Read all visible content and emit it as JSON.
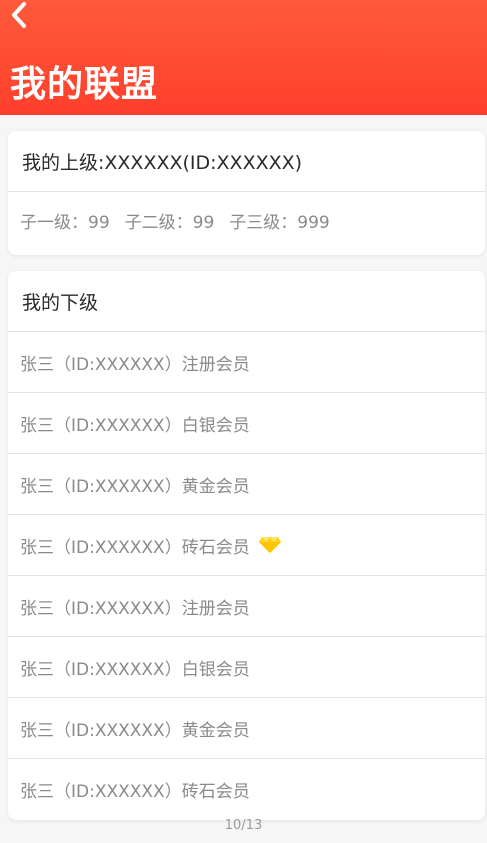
{
  "header": {
    "title": "我的联盟"
  },
  "superior": {
    "heading": "我的上级:XXXXXX(ID:XXXXXX)",
    "counts": [
      {
        "text": "子一级：99"
      },
      {
        "text": "子二级：99"
      },
      {
        "text": "子三级：999"
      }
    ]
  },
  "subordinates": {
    "heading": "我的下级",
    "rows": [
      {
        "text": "张三（ID:XXXXXX）注册会员"
      },
      {
        "text": "张三（ID:XXXXXX）白银会员"
      },
      {
        "text": "张三（ID:XXXXXX）黄金会员"
      },
      {
        "text": "张三（ID:XXXXXX）砖石会员",
        "badge_icon": "diamond-icon"
      },
      {
        "text": "张三（ID:XXXXXX）注册会员"
      },
      {
        "text": "张三（ID:XXXXXX）白银会员"
      },
      {
        "text": "张三（ID:XXXXXX）黄金会员"
      },
      {
        "text": "张三（ID:XXXXXX）砖石会员"
      }
    ]
  },
  "pager": {
    "text": "10/13"
  },
  "colors": {
    "header_top": "#ff5a3a",
    "header_bottom": "#ff3f2c",
    "diamond": "#ffd21a"
  }
}
